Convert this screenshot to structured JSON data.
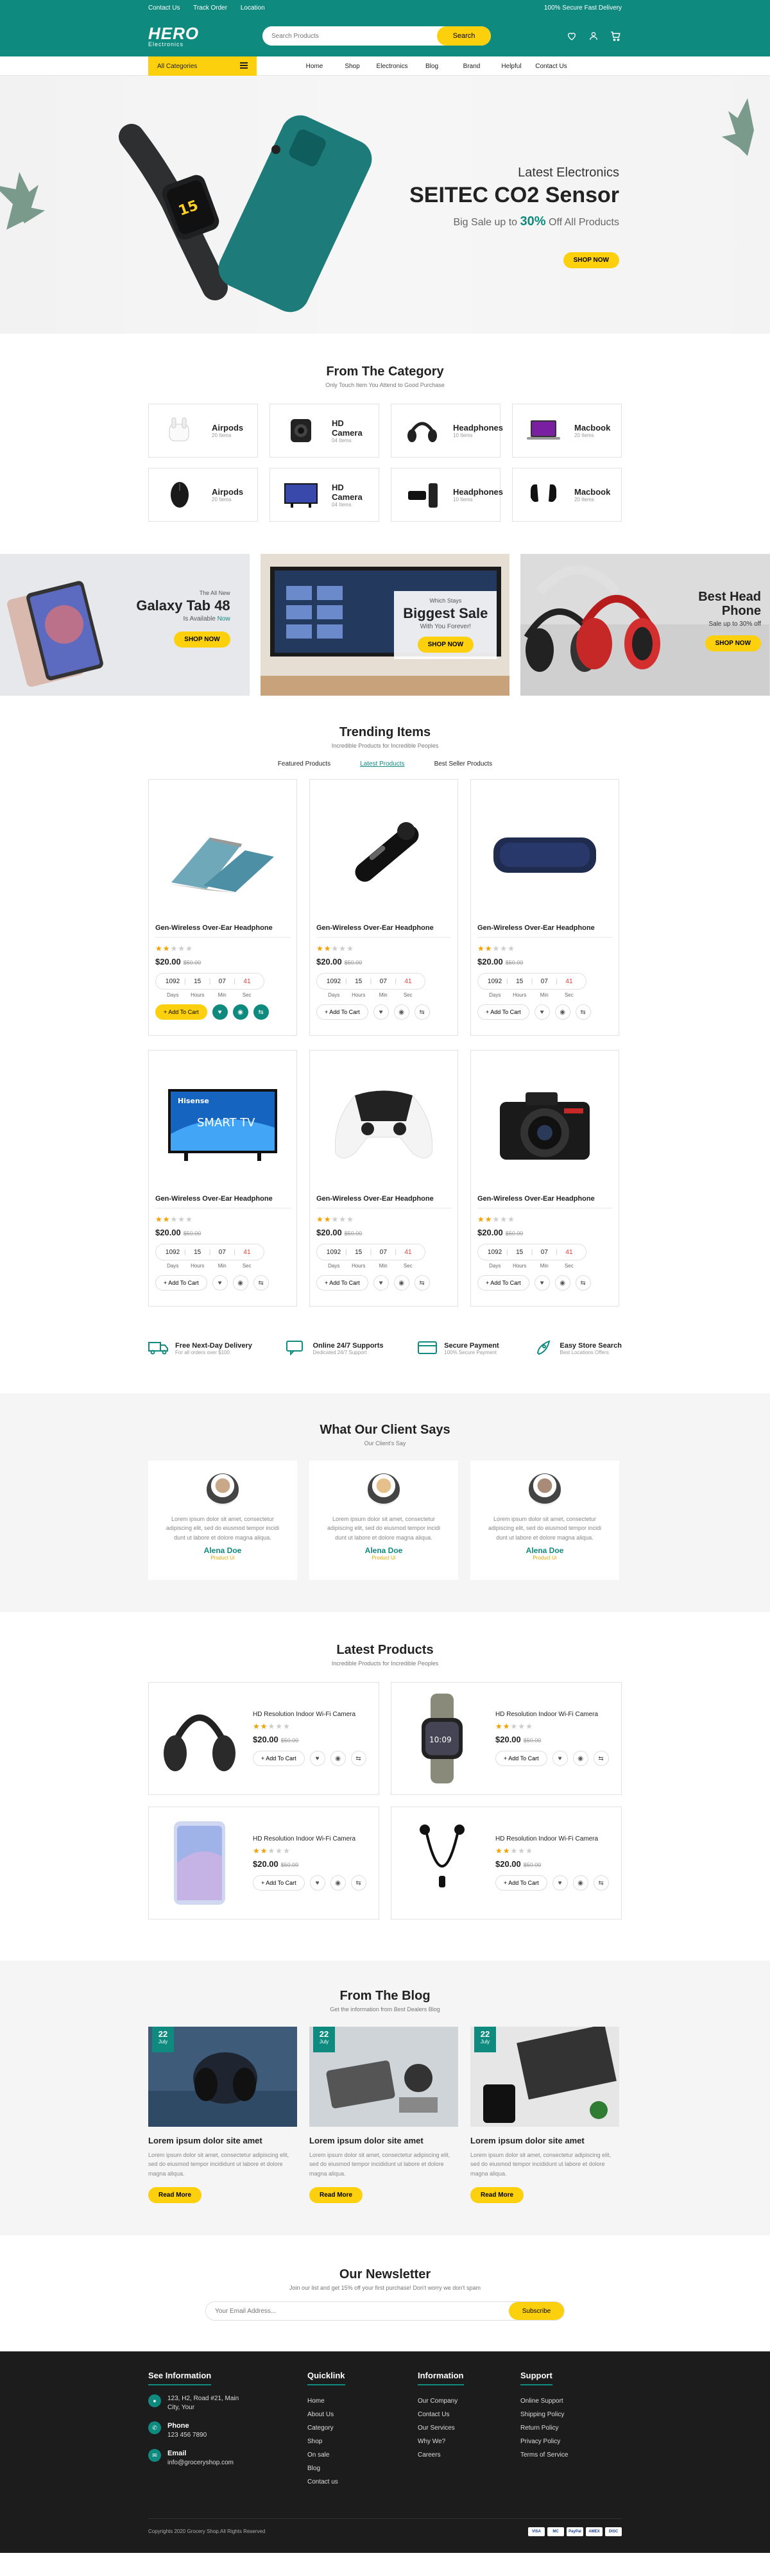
{
  "topbar": {
    "links": [
      "Contact Us",
      "Track Order",
      "Location"
    ],
    "note": "100% Secure Fast Delivery"
  },
  "brand": {
    "name": "HERO",
    "tag": "Electronics"
  },
  "search": {
    "placeholder": "Search Products",
    "button": "Search"
  },
  "nav": {
    "category_label": "All Categories",
    "items": [
      "Home",
      "Shop",
      "Electronics",
      "Blog",
      "Brand",
      "Helpful",
      "Contact Us"
    ]
  },
  "hero": {
    "subtitle": "Latest Electronics",
    "title": "SEITEC CO2 Sensor",
    "offer_pre": "Big Sale up to",
    "offer_pct": "30%",
    "offer_post": "Off All Products",
    "button": "SHOP NOW"
  },
  "categories": {
    "title": "From The Category",
    "subtitle": "Only Touch Item You Attend to Good Purchase",
    "items": [
      {
        "name": "Airpods",
        "count": "20 Items",
        "icon": "airpods-icon"
      },
      {
        "name": "HD Camera",
        "count": "04 Items",
        "icon": "camera-icon"
      },
      {
        "name": "Headphones",
        "count": "10 Items",
        "icon": "headphones-icon"
      },
      {
        "name": "Macbook",
        "count": "20 Items",
        "icon": "laptop-icon"
      },
      {
        "name": "Airpods",
        "count": "20 Items",
        "icon": "mouse-icon"
      },
      {
        "name": "HD Camera",
        "count": "04 Items",
        "icon": "tv-icon"
      },
      {
        "name": "Headphones",
        "count": "10 Items",
        "icon": "speaker-icon"
      },
      {
        "name": "Macbook",
        "count": "20 Items",
        "icon": "earbuds-icon"
      }
    ]
  },
  "banners": [
    {
      "pre": "The All New",
      "title": "Galaxy Tab 48",
      "post": "Is Available ",
      "post_accent": "Now",
      "button": "SHOP NOW"
    },
    {
      "pre": "Which Stays",
      "title": "Biggest Sale",
      "post": "With You Forever!",
      "button": "SHOP NOW"
    },
    {
      "pre": "",
      "title": "Best Head Phone",
      "post": "Sale up to 30% off",
      "button": "SHOP NOW"
    }
  ],
  "trending": {
    "title": "Trending Items",
    "subtitle": "Incredible Products for Incredible Peoples",
    "tabs": [
      "Featured Products",
      "Latest Products",
      "Best Seller Products"
    ],
    "active_tab": 1,
    "products": [
      {
        "image": "laptop",
        "name": "Gen-Wireless Over-Ear Headphone",
        "rating": 2,
        "price": "$20.00",
        "old_price": "$50.00",
        "timer": [
          "1092",
          "15",
          "07",
          "41"
        ],
        "timer_labels": [
          "Days",
          "Hours",
          "Min",
          "Sec"
        ],
        "cart": "+ Add To Cart"
      },
      {
        "image": "earpiece",
        "name": "Gen-Wireless Over-Ear Headphone",
        "rating": 2,
        "price": "$20.00",
        "old_price": "$50.00",
        "timer": [
          "1092",
          "15",
          "07",
          "41"
        ],
        "timer_labels": [
          "Days",
          "Hours",
          "Min",
          "Sec"
        ],
        "cart": "+ Add To Cart"
      },
      {
        "image": "speaker",
        "name": "Gen-Wireless Over-Ear Headphone",
        "rating": 2,
        "price": "$20.00",
        "old_price": "$50.00",
        "timer": [
          "1092",
          "15",
          "07",
          "41"
        ],
        "timer_labels": [
          "Days",
          "Hours",
          "Min",
          "Sec"
        ],
        "cart": "+ Add To Cart"
      },
      {
        "image": "tv",
        "name": "Gen-Wireless Over-Ear Headphone",
        "rating": 2,
        "price": "$20.00",
        "old_price": "$50.00",
        "timer": [
          "1092",
          "15",
          "07",
          "41"
        ],
        "timer_labels": [
          "Days",
          "Hours",
          "Min",
          "Sec"
        ],
        "cart": "+ Add To Cart",
        "tv_brand": "Hisense",
        "tv_text": "SMART TV"
      },
      {
        "image": "gamepad",
        "name": "Gen-Wireless Over-Ear Headphone",
        "rating": 2,
        "price": "$20.00",
        "old_price": "$50.00",
        "timer": [
          "1092",
          "15",
          "07",
          "41"
        ],
        "timer_labels": [
          "Days",
          "Hours",
          "Min",
          "Sec"
        ],
        "cart": "+ Add To Cart"
      },
      {
        "image": "dslr",
        "name": "Gen-Wireless Over-Ear Headphone",
        "rating": 2,
        "price": "$20.00",
        "old_price": "$50.00",
        "timer": [
          "1092",
          "15",
          "07",
          "41"
        ],
        "timer_labels": [
          "Days",
          "Hours",
          "Min",
          "Sec"
        ],
        "cart": "+ Add To Cart"
      }
    ]
  },
  "features": [
    {
      "title": "Free Next-Day Delivery",
      "sub": "For all orders over $100",
      "icon": "truck-icon"
    },
    {
      "title": "Online 24/7 Supports",
      "sub": "Dedicated 24/7 Support",
      "icon": "chat-icon"
    },
    {
      "title": "Secure Payment",
      "sub": "100% Secure Payment",
      "icon": "card-icon"
    },
    {
      "title": "Easy Store Search",
      "sub": "Best Locations Offers",
      "icon": "rocket-icon"
    }
  ],
  "testimonials": {
    "title": "What Our Client Says",
    "subtitle": "Our Client's Say",
    "items": [
      {
        "text": "Lorem ipsum dolor sit amet, consectetur adipiscing elit, sed do eiusmod tempor incidi dunt ut labore et dolore magna aliqua.",
        "name": "Alena Doe",
        "role": "Product Ui"
      },
      {
        "text": "Lorem ipsum dolor sit amet, consectetur adipiscing elit, sed do eiusmod tempor incidi dunt ut labore et dolore magna aliqua.",
        "name": "Alena Doe",
        "role": "Product Ui"
      },
      {
        "text": "Lorem ipsum dolor sit amet, consectetur adipiscing elit, sed do eiusmod tempor incidi dunt ut labore et dolore magna aliqua.",
        "name": "Alena Doe",
        "role": "Product Ui"
      }
    ]
  },
  "latest": {
    "title": "Latest Products",
    "subtitle": "Incredible Products for Incredible Peoples",
    "items": [
      {
        "image": "headphones",
        "name": "HD Resolution Indoor Wi-Fi Camera",
        "rating": 2,
        "price": "$20.00",
        "old_price": "$50.00",
        "cart": "+ Add To Cart"
      },
      {
        "image": "watch",
        "name": "HD Resolution Indoor Wi-Fi Camera",
        "rating": 2,
        "price": "$20.00",
        "old_price": "$50.00",
        "cart": "+ Add To Cart"
      },
      {
        "image": "phone",
        "name": "HD Resolution Indoor Wi-Fi Camera",
        "rating": 2,
        "price": "$20.00",
        "old_price": "$50.00",
        "cart": "+ Add To Cart"
      },
      {
        "image": "earphones",
        "name": "HD Resolution Indoor Wi-Fi Camera",
        "rating": 2,
        "price": "$20.00",
        "old_price": "$50.00",
        "cart": "+ Add To Cart"
      }
    ]
  },
  "blog": {
    "title": "From The Blog",
    "subtitle": "Get the information from Best Dealers Blog",
    "items": [
      {
        "day": "22",
        "month": "July",
        "title": "Lorem ipsum dolor site amet",
        "text": "Lorem ipsum dolor sit amet, consectetur adipiscing elit, sed do eiusmod tempor incididunt ut labore et dolore magna aliqua.",
        "button": "Read More"
      },
      {
        "day": "22",
        "month": "July",
        "title": "Lorem ipsum dolor site amet",
        "text": "Lorem ipsum dolor sit amet, consectetur adipiscing elit, sed do eiusmod tempor incididunt ut labore et dolore magna aliqua.",
        "button": "Read More"
      },
      {
        "day": "22",
        "month": "July",
        "title": "Lorem ipsum dolor site amet",
        "text": "Lorem ipsum dolor sit amet, consectetur adipiscing elit, sed do eiusmod tempor incididunt ut labore et dolore magna aliqua.",
        "button": "Read More"
      }
    ]
  },
  "newsletter": {
    "title": "Our Newsletter",
    "subtitle": "Join our list and get 15% off your first purchase! Don't worry we don't spam",
    "placeholder": "Your Email Address...",
    "button": "Subscribe"
  },
  "footer": {
    "see_info": {
      "title": "See Information",
      "address": "123, H2, Road #21, Main City, Your",
      "phone_label": "Phone",
      "phone": "123 456 7890",
      "email_label": "Email",
      "email": "info@groceryshop.com"
    },
    "quicklink": {
      "title": "Quicklink",
      "items": [
        "Home",
        "About Us",
        "Category",
        "Shop",
        "On sale",
        "Blog",
        "Contact us"
      ]
    },
    "information": {
      "title": "Information",
      "items": [
        "Our Company",
        "Contact Us",
        "Our Services",
        "Why We?",
        "Careers"
      ]
    },
    "support": {
      "title": "Support",
      "items": [
        "Online Support",
        "Shipping Policy",
        "Return Policy",
        "Privacy Policy",
        "Terms of Service"
      ]
    },
    "copyright": "Copyrights 2020 Grocery Shop.All Rights Reserved",
    "payments": [
      "VISA",
      "MC",
      "PayPal",
      "AMEX",
      "DISC"
    ]
  },
  "colors": {
    "teal": "#0f8a7e",
    "yellow": "#fcd00d",
    "dark": "#1c1c1c",
    "red": "#e53935"
  }
}
